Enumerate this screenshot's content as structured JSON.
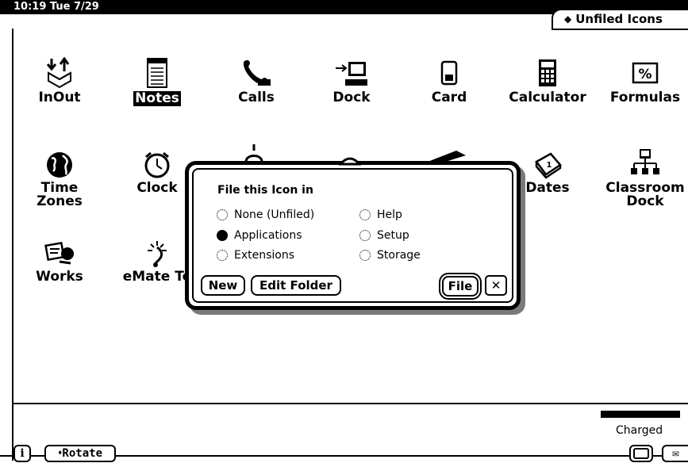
{
  "status_bar": {
    "clock": "10:19 Tue 7/29",
    "folder": "Unfiled Icons",
    "folder_marker": "◆"
  },
  "icons": [
    {
      "label": "InOut",
      "icon": "inout-icon"
    },
    {
      "label": "Notes",
      "icon": "notes-icon",
      "selected": true
    },
    {
      "label": "Calls",
      "icon": "phone-icon"
    },
    {
      "label": "Dock",
      "icon": "dock-icon"
    },
    {
      "label": "Card",
      "icon": "card-icon"
    },
    {
      "label": "Calculator",
      "icon": "calculator-icon"
    },
    {
      "label": "Formulas",
      "icon": "formulas-icon"
    },
    {
      "label": "Time\nZones",
      "icon": "globe-icon"
    },
    {
      "label": "Clock",
      "icon": "alarm-clock-icon"
    },
    {
      "label": "Dates",
      "icon": "calendar-icon"
    },
    {
      "label": "Classroom\nDock",
      "icon": "network-icon"
    },
    {
      "label": "Works",
      "icon": "works-icon"
    },
    {
      "label": "eMate To",
      "icon": "emate-tour-icon"
    }
  ],
  "dialog": {
    "title": "File this Icon in",
    "options": [
      {
        "label": "None (Unfiled)",
        "selected": false
      },
      {
        "label": "Applications",
        "selected": true
      },
      {
        "label": "Extensions",
        "selected": false
      },
      {
        "label": "Help",
        "selected": false
      },
      {
        "label": "Setup",
        "selected": false
      },
      {
        "label": "Storage",
        "selected": false
      }
    ],
    "buttons": {
      "new": "New",
      "edit_folder": "Edit Folder",
      "file": "File",
      "close": "✕"
    }
  },
  "bottom_bar": {
    "info": "i",
    "rotate": "Rotate",
    "rotate_marker": "♦",
    "battery_status": "Charged"
  }
}
